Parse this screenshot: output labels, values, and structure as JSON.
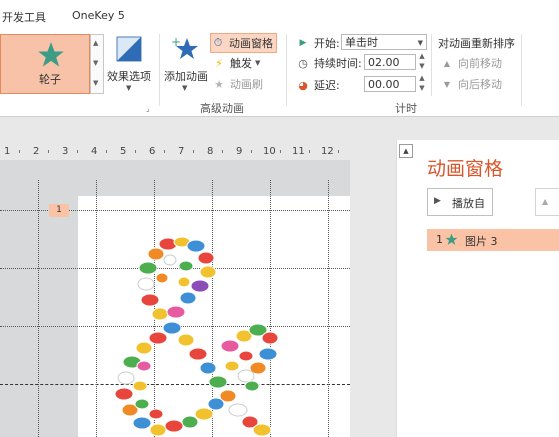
{
  "tabs": [
    "开发工具",
    "OneKey 5"
  ],
  "ribbon": {
    "animation_gallery": {
      "selected_label": "轮子"
    },
    "effect_options": "效果选项",
    "add_animation": "添加动画",
    "animation_pane": "动画窗格",
    "trigger": "触发",
    "animation_painter": "动画刷",
    "advanced_group": "高级动画",
    "timing": {
      "start_label": "开始:",
      "start_value": "单击时",
      "duration_label": "持续时间:",
      "duration_value": "02.00",
      "delay_label": "延迟:",
      "delay_value": "00.00",
      "group_label": "计时"
    },
    "reorder": {
      "title": "对动画重新排序",
      "move_earlier": "向前移动",
      "move_later": "向后移动"
    }
  },
  "ruler": [
    "1",
    "2",
    "3",
    "4",
    "5",
    "6",
    "7",
    "8",
    "9",
    "10",
    "11",
    "12"
  ],
  "slide": {
    "anim_badge": "1"
  },
  "pane": {
    "title": "动画窗格",
    "play_label": "播放自",
    "items": [
      {
        "order": "1",
        "name": "图片 3"
      }
    ]
  },
  "colors": {
    "accent": "#d9552b",
    "selection": "#fbc3a5",
    "star": "#3d9c86"
  }
}
